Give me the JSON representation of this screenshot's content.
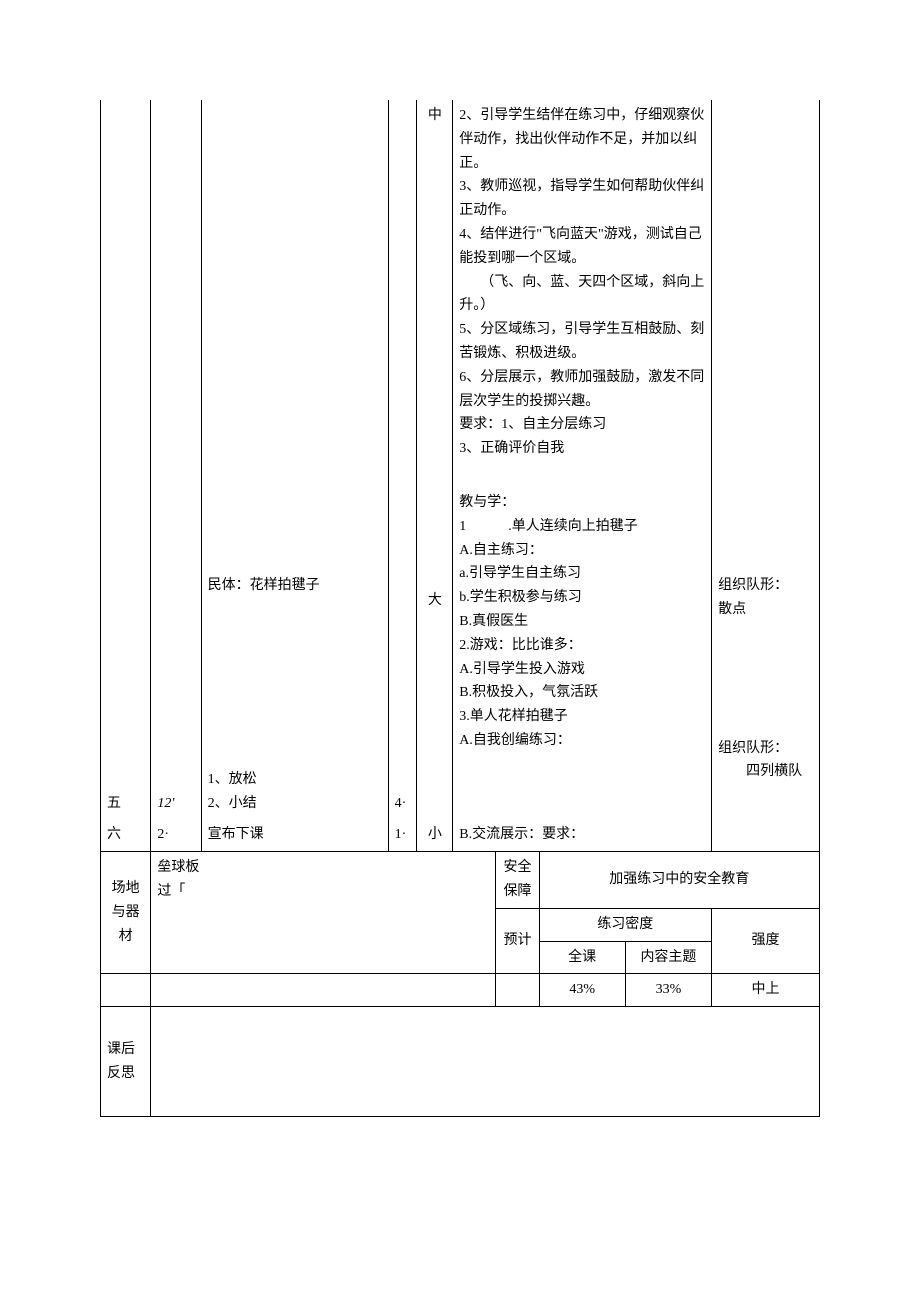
{
  "upper": {
    "row5_col1": "五",
    "row5_col2": "12′",
    "row5_col4": "4·",
    "row6_col1": "六",
    "row6_col2": "2·",
    "row6_col4": "1·",
    "content_col3_a": "民体：花样拍毽子",
    "content_col3_b_lines": [
      "1、放松",
      "2、小结",
      "宣布下课"
    ],
    "content_col5_top": "中",
    "content_col5_mid": "大",
    "content_col5_bot": "小",
    "content_col6_block1_lines": [
      "2、引导学生结伴在练习中，仔细观察伙伴动作，找出伙伴动作不足，并加以纠正。",
      "3、教师巡视，指导学生如何帮助伙伴纠正动作。",
      "4、结伴进行\"飞向蓝天\"游戏，测试自己能投到哪一个区域。",
      "　　（飞、向、蓝、天四个区域，斜向上升。）",
      "5、分区域练习，引导学生互相鼓励、刻苦锻炼、积极进级。",
      "6、分层展示，教师加强鼓励，激发不同层次学生的投掷兴趣。",
      "要求：1、自主分层练习",
      "3、正确评价自我"
    ],
    "content_col6_block2_lines": [
      "教与学：",
      "1　　　.单人连续向上拍毽子",
      "A.自主练习：",
      "a.引导学生自主练习",
      "b.学生积极参与练习",
      "B.真假医生",
      "2.游戏：比比谁多：",
      "A.引导学生投入游戏",
      "B.积极投入，气氛活跃",
      "3.单人花样拍毽子",
      "A.自我创编练习：",
      "B.交流展示：要求："
    ],
    "content_col7_a_lines": [
      "组织队形：",
      "",
      "散点"
    ],
    "content_col7_b_lines": [
      "组织队形：",
      "　　四列横队"
    ]
  },
  "lower": {
    "label_venue_lines": [
      "场地与器材"
    ],
    "venue_content_lines": [
      "垒球板",
      "过「"
    ],
    "label_safety_lines": [
      "安全保障"
    ],
    "safety_content": "加强练习中的安全教育",
    "label_forecast": "预计",
    "header_density": "练习密度",
    "header_strength": "强度",
    "header_full": "全课",
    "header_topic": "内容主题",
    "val_full": "43%",
    "val_topic": "33%",
    "val_strength": "中上",
    "label_reflection_lines": [
      "课后反思"
    ]
  }
}
